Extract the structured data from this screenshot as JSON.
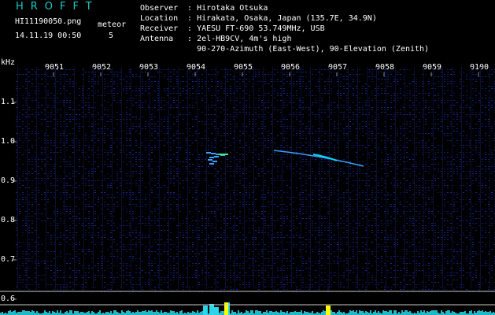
{
  "header": {
    "app_title": "HROFFT",
    "filename": "HI11190050.png",
    "datetime": "14.11.19 00:50",
    "meteor_label": "meteor",
    "meteor_count": "5"
  },
  "station": {
    "observer_label": "Observer",
    "observer": "Hirotaka Otsuka",
    "location_label": "Location",
    "location": "Hirakata, Osaka, Japan (135.7E, 34.9N)",
    "receiver_label": "Receiver",
    "receiver": "YAESU FT-690 53.749MHz, USB",
    "antenna_label": "Antenna",
    "antenna_line1": "2el-HB9CV, 4m's high",
    "antenna_line2": "90-270-Azimuth (East-West), 90-Elevation (Zenith)"
  },
  "spectrogram": {
    "y_unit": "kHz",
    "time_ticks": [
      "0051",
      "0052",
      "0053",
      "0054",
      "0055",
      "0056",
      "0057",
      "0058",
      "0059",
      "0100"
    ],
    "freq_ticks": [
      "1.1",
      "1.0",
      "0.9",
      "0.8",
      "0.7",
      "0.6"
    ],
    "colors": {
      "background": "#000000",
      "noise": "#1a2a8c",
      "echo": "#3ca0ff",
      "echo_core": "#30ff70",
      "trace": "#00d8ff",
      "peak": "#ffff00",
      "grid": "#c8c8c8"
    }
  }
}
